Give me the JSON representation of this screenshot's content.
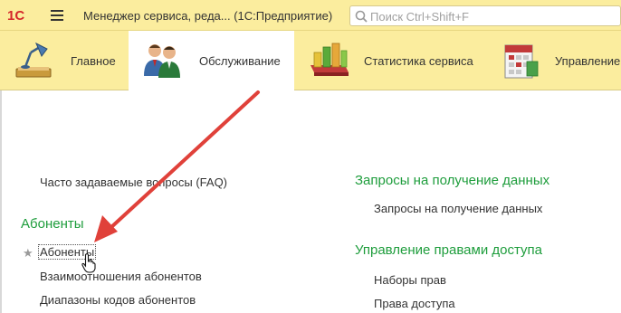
{
  "window": {
    "logo_text": "1С",
    "title": "Менеджер сервиса, реда...  (1С:Предприятие)"
  },
  "search": {
    "placeholder": "Поиск Ctrl+Shift+F"
  },
  "sections": [
    {
      "label": "Главное",
      "icon": "desk-lamp-icon"
    },
    {
      "label": "Обслуживание",
      "icon": "users-icon",
      "active": true
    },
    {
      "label": "Статистика сервиса",
      "icon": "bar-chart-icon"
    },
    {
      "label": "Управление",
      "icon": "calendar-icon"
    }
  ],
  "content": {
    "faq_link": "Часто задаваемые вопросы (FAQ)",
    "subscribers_group": {
      "title": "Абоненты",
      "items": [
        "Абоненты",
        "Взаимоотношения абонентов",
        "Диапазоны кодов абонентов"
      ]
    },
    "data_requests_group": {
      "title": "Запросы на получение данных",
      "items": [
        "Запросы на получение данных"
      ]
    },
    "access_group": {
      "title": "Управление правами доступа",
      "items": [
        "Наборы прав",
        "Права доступа"
      ]
    },
    "favorite_star": "★"
  },
  "colors": {
    "header_bg": "#fbed9e",
    "group_title": "#1e9d3c",
    "annotation_arrow": "#e0413a",
    "logo_red": "#d4262b"
  }
}
